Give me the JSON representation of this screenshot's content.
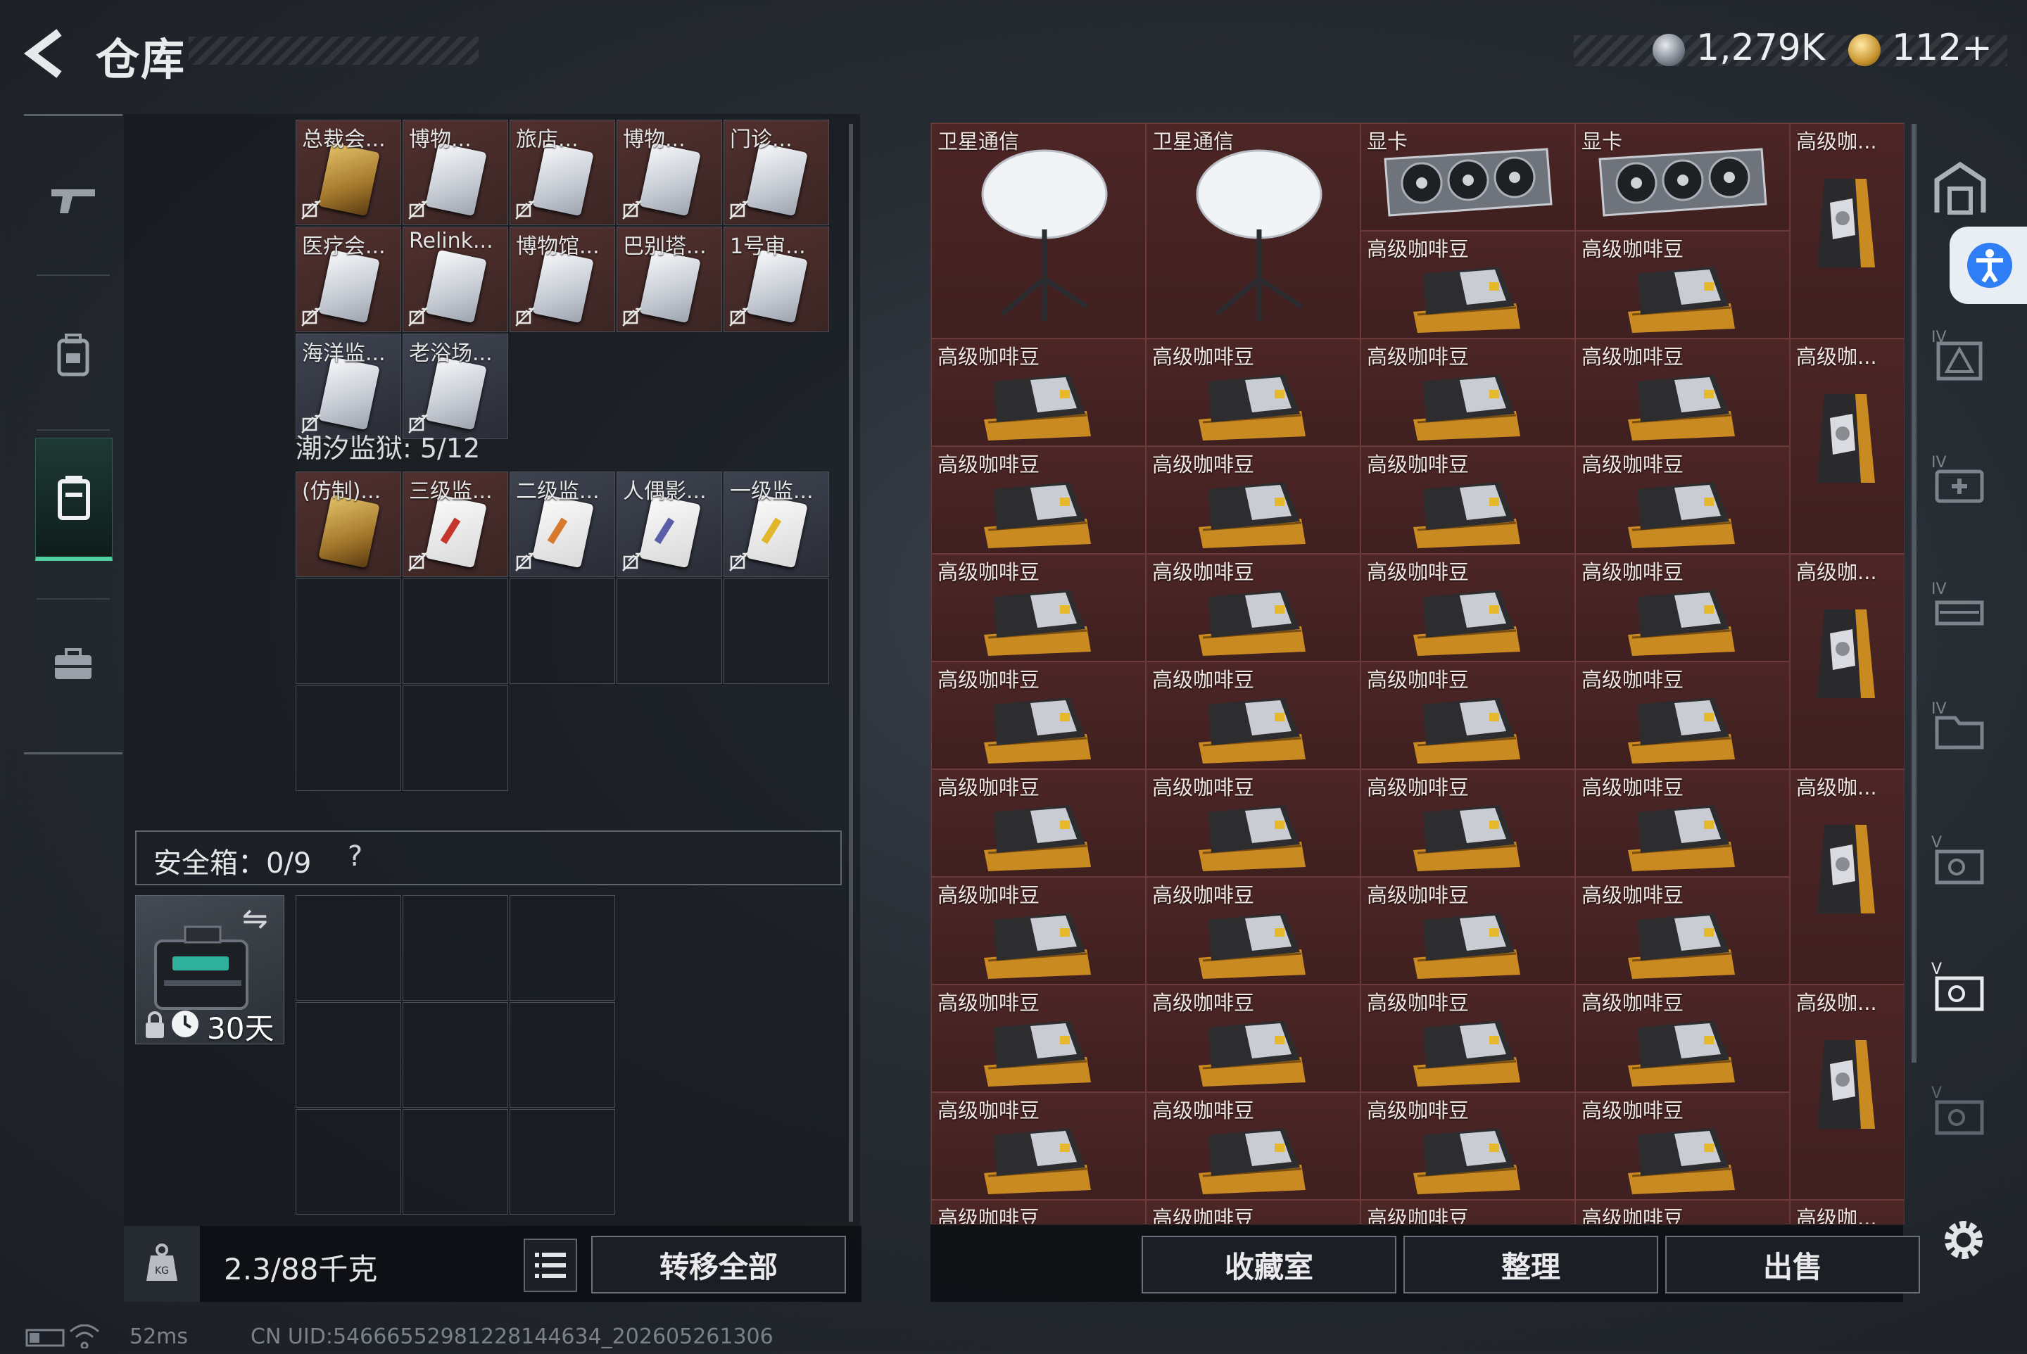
{
  "header": {
    "title": "仓库",
    "currency": [
      {
        "name": "silver-coin-icon",
        "value": "1,279K"
      },
      {
        "name": "gold-coin-icon",
        "value": "112+"
      }
    ]
  },
  "nav": {
    "items": [
      {
        "name": "gun-icon",
        "active": false
      },
      {
        "name": "backpack-icon",
        "active": false
      },
      {
        "name": "ammo-box-icon",
        "active": true
      },
      {
        "name": "briefcase-icon",
        "active": false
      }
    ]
  },
  "storage": {
    "row1": [
      {
        "label": "总裁会...",
        "style": "brown",
        "card": "gold"
      },
      {
        "label": "博物...",
        "style": "brown",
        "card": "white"
      },
      {
        "label": "旅店...",
        "style": "brown",
        "card": "white"
      },
      {
        "label": "博物...",
        "style": "brown",
        "card": "white"
      },
      {
        "label": "门诊...",
        "style": "brown",
        "card": "white"
      }
    ],
    "row2": [
      {
        "label": "医疗会...",
        "style": "brown",
        "card": "white"
      },
      {
        "label": "Relink...",
        "style": "brown",
        "card": "white"
      },
      {
        "label": "博物馆...",
        "style": "brown",
        "card": "white"
      },
      {
        "label": "巴别塔...",
        "style": "brown",
        "card": "white"
      },
      {
        "label": "1号审...",
        "style": "brown",
        "card": "white"
      }
    ],
    "row3": [
      {
        "label": "海洋监...",
        "style": "gray",
        "card": "white"
      },
      {
        "label": "老浴场...",
        "style": "gray",
        "card": "white"
      }
    ],
    "prison_label": "潮汐监狱: 5/12",
    "prison_row": [
      {
        "label": "(仿制)...",
        "style": "brown",
        "card": "gold",
        "stripe": ""
      },
      {
        "label": "三级监...",
        "style": "brown",
        "card": "red",
        "stripe": "red"
      },
      {
        "label": "二级监...",
        "style": "gray",
        "card": "red",
        "stripe": "orange"
      },
      {
        "label": "人偶影...",
        "style": "gray",
        "card": "red",
        "stripe": "blue"
      },
      {
        "label": "一级监...",
        "style": "gray",
        "card": "red",
        "stripe": "yellow"
      }
    ]
  },
  "safebox": {
    "label": "安全箱：0/9",
    "help": "?",
    "swap_icon": "⇋",
    "duration": "30天"
  },
  "footer_left": {
    "weight": "2.3/88千克",
    "transfer_label": "转移全部"
  },
  "items": {
    "satellite": "卫星通信",
    "gpu": "显卡",
    "coffee": "高级咖啡豆",
    "coffee_short": "高级咖..."
  },
  "footer_right": {
    "collection_label": "收藏室",
    "sort_label": "整理",
    "sell_label": "出售"
  },
  "status_bar": {
    "ping": "52ms",
    "uid": "CN UID:546665529812281446​34_202605261306"
  },
  "colors": {
    "accent": "#4fd0a1",
    "item_bg": "#4d2626"
  }
}
